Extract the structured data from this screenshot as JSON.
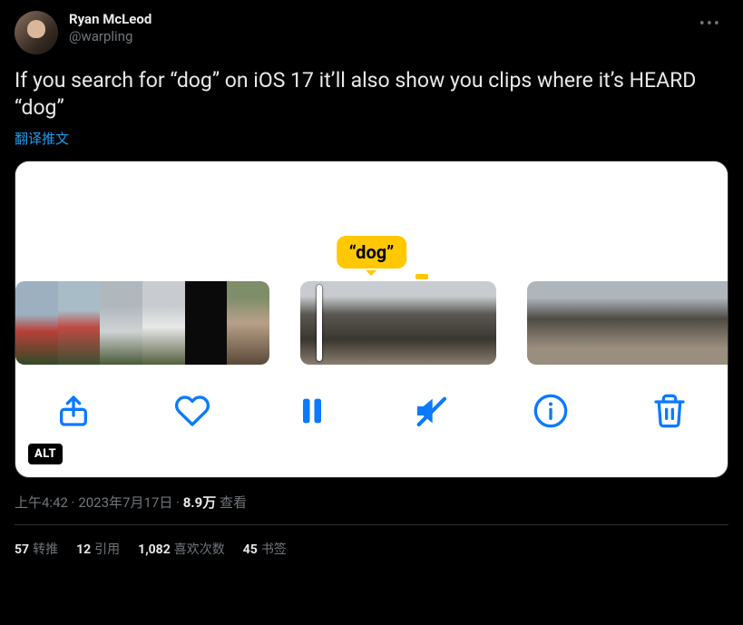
{
  "author": {
    "name": "Ryan McLeod",
    "handle": "@warpling"
  },
  "content": "If you search for “dog” on iOS 17 it’ll also show you clips where it’s HEARD “dog”",
  "translate_label": "翻译推文",
  "media": {
    "tooltip": "“dog”",
    "alt_badge": "ALT"
  },
  "meta": {
    "time": "上午4:42",
    "date": "2023年7月17日",
    "views_count": "8.9万",
    "views_label": "查看",
    "sep": " · "
  },
  "stats": {
    "retweets": {
      "count": "57",
      "label": "转推"
    },
    "quotes": {
      "count": "12",
      "label": "引用"
    },
    "likes": {
      "count": "1,082",
      "label": "喜欢次数"
    },
    "bookmarks": {
      "count": "45",
      "label": "书签"
    }
  }
}
